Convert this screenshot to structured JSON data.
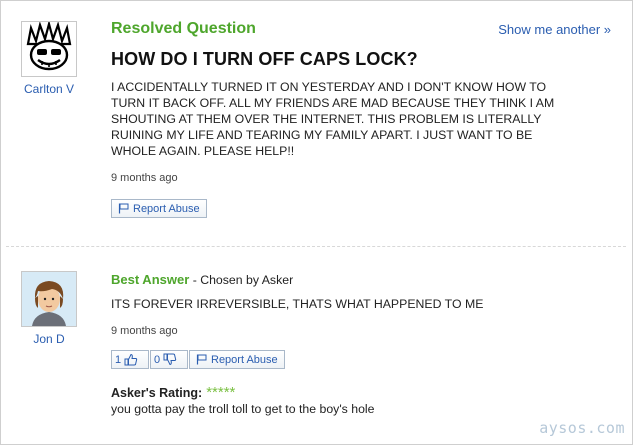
{
  "question": {
    "section_label": "Resolved Question",
    "show_another": "Show me another »",
    "asker_name": "Carlton V",
    "title": "HOW DO I TURN OFF CAPS LOCK?",
    "body_lines": [
      "I ACCIDENTALLY TURNED IT ON YESTERDAY AND I DON'T KNOW HOW TO",
      "TURN IT BACK OFF. ALL MY FRIENDS ARE MAD BECAUSE THEY THINK I AM",
      "SHOUTING AT THEM OVER THE INTERNET. THIS PROBLEM IS LITERALLY",
      "RUINING MY LIFE AND TEARING MY FAMILY APART. I JUST WANT TO BE",
      "WHOLE AGAIN. PLEASE HELP!!"
    ],
    "time": "9 months ago",
    "report_abuse": "Report Abuse"
  },
  "answer": {
    "label": "Best Answer",
    "chosen_by": " - Chosen by Asker",
    "answerer_name": "Jon D",
    "text": "ITS FOREVER IRREVERSIBLE, THATS WHAT HAPPENED TO ME",
    "time": "9 months ago",
    "thumbs_up_count": "1",
    "thumbs_down_count": "0",
    "report_abuse": "Report Abuse",
    "rating_label": "Asker's Rating:",
    "rating_stars": "*****",
    "rating_value": 5,
    "comment": "you gotta pay the troll toll to get to the boy's hole"
  },
  "watermark": "aysos.com",
  "colors": {
    "accent_green": "#4ea62c",
    "link_blue": "#2a5db0",
    "star_green": "#7bc043"
  }
}
